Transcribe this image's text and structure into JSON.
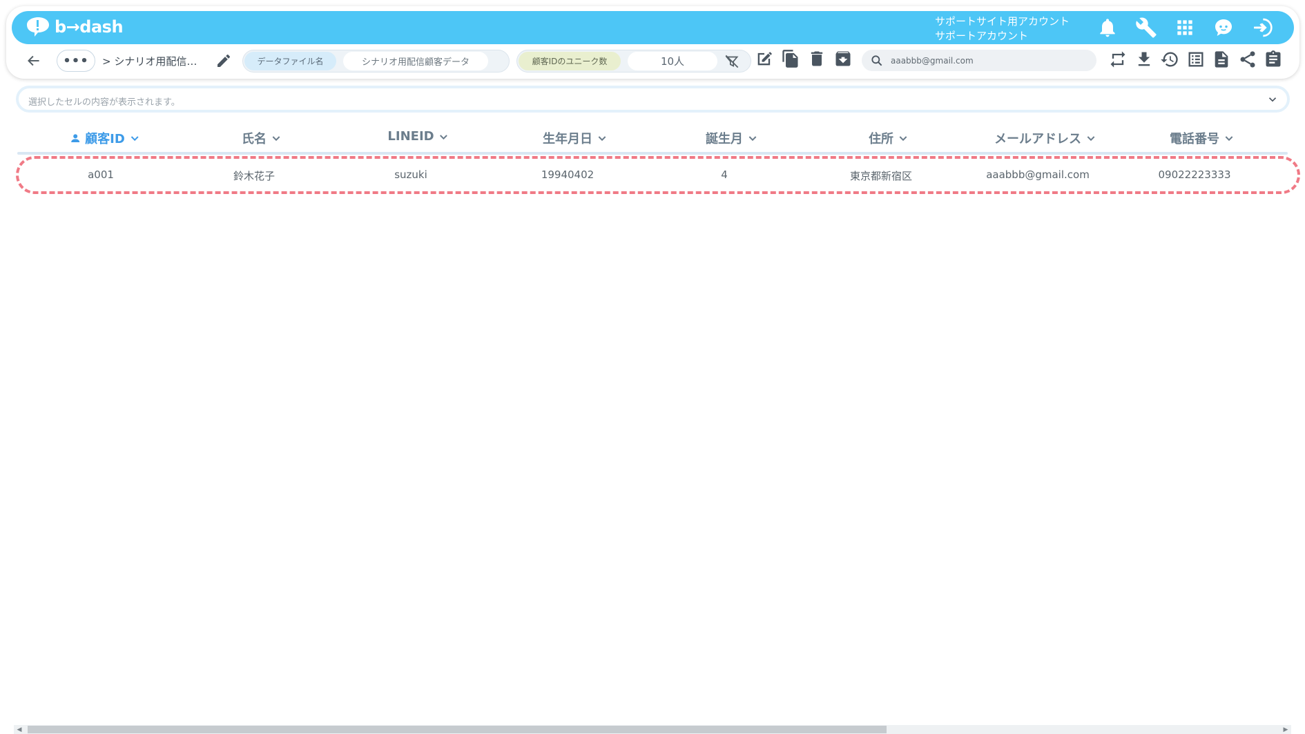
{
  "app": {
    "logo_text": "b→dash"
  },
  "account": {
    "line1": "サポートサイト用アカウント",
    "line2": "サポートアカウント"
  },
  "topbar_icons": [
    "bell-icon",
    "wrench-icon",
    "grid-apps-icon",
    "help-chat-icon",
    "logout-icon"
  ],
  "toolbar": {
    "more_label": "•••",
    "breadcrumb": "> シナリオ用配信…",
    "datafile_label": "データファイル名",
    "datafile_value": "シナリオ用配信顧客データ",
    "unique_label": "顧客IDのユニーク数",
    "unique_value": "10人",
    "search_value": "aaabbb@gmail.com"
  },
  "cell_viewer": {
    "placeholder": "選択したセルの内容が表示されます。"
  },
  "table": {
    "columns": [
      "顧客ID",
      "氏名",
      "LINEID",
      "生年月日",
      "誕生月",
      "住所",
      "メールアドレス",
      "電話番号"
    ],
    "rows": [
      [
        "a001",
        "鈴木花子",
        "suzuki",
        "19940402",
        "4",
        "東京都新宿区",
        "aaabbb@gmail.com",
        "09022223333"
      ]
    ]
  },
  "colors": {
    "topbar": "#4dc6f6",
    "highlight": "#f07a86",
    "active_column": "#3d9be8"
  }
}
